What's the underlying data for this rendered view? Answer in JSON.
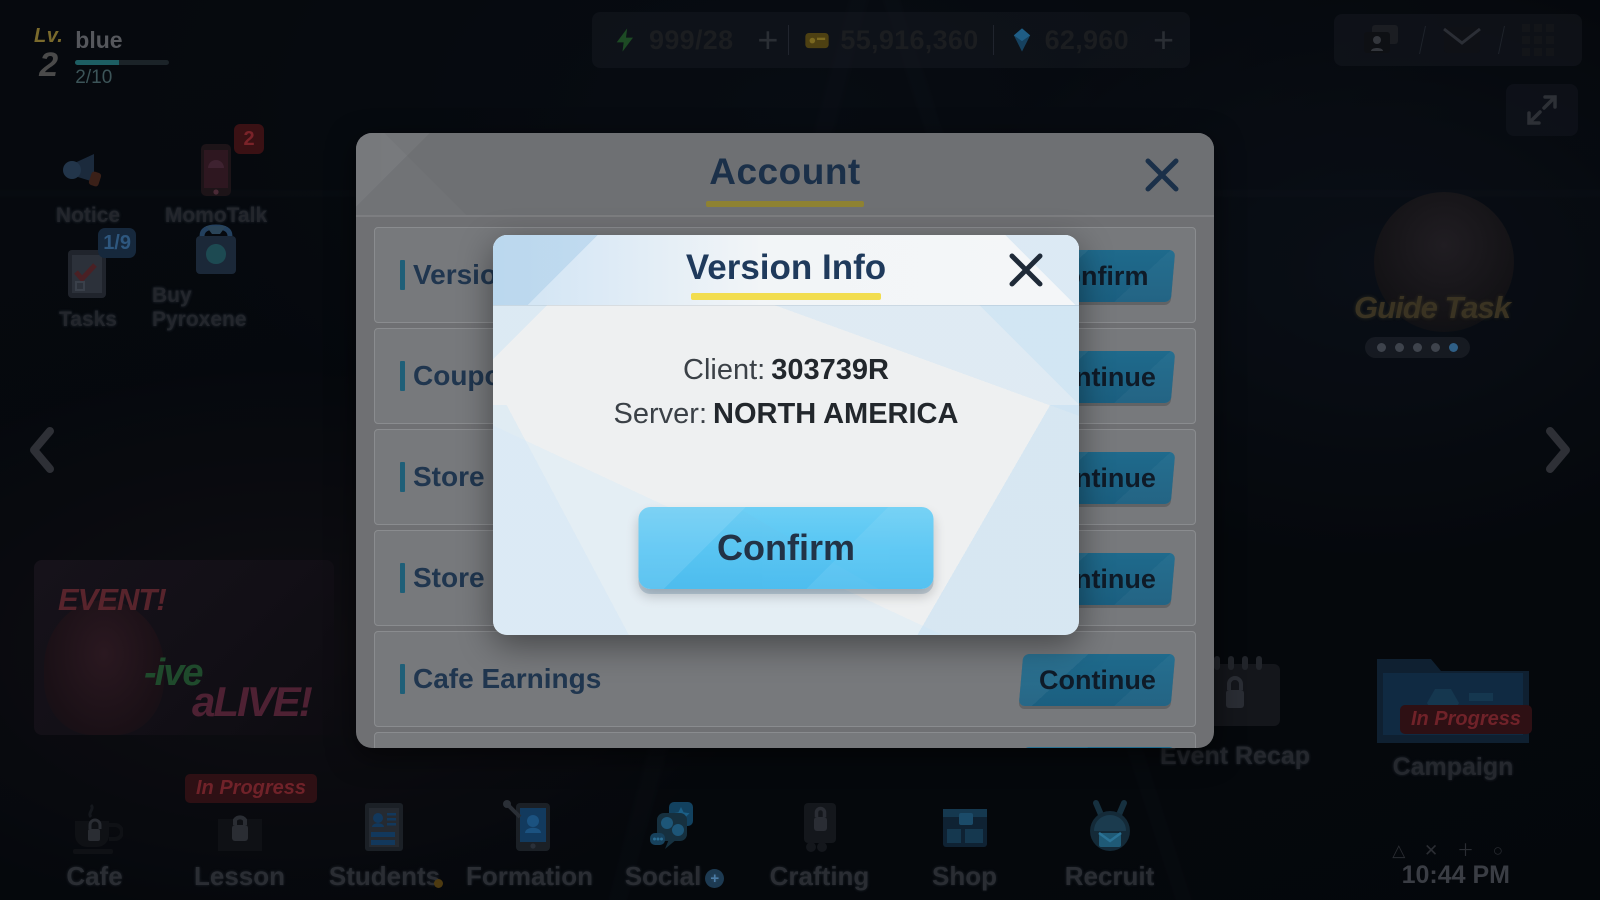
{
  "player": {
    "level_word": "Lv.",
    "level": "2",
    "name": "blue",
    "xp": "2/10"
  },
  "currencies": [
    {
      "icon": "ap-bolt-icon",
      "value": "999/28",
      "plus": "+"
    },
    {
      "icon": "credit-icon",
      "value": "55,916,360",
      "plus": ""
    },
    {
      "icon": "pyroxene-icon",
      "value": "62,960",
      "plus": "+"
    }
  ],
  "top_right_buttons": [
    {
      "icon": "profile-card-icon",
      "name": "profile-card-button"
    },
    {
      "icon": "mail-icon",
      "name": "mail-button"
    },
    {
      "icon": "grid-menu-icon",
      "name": "menu-button"
    }
  ],
  "expand_button": {
    "icon": "expand-arrows-icon"
  },
  "left_menu": [
    {
      "label": "Notice",
      "icon": "megaphone-icon",
      "badge": ""
    },
    {
      "label": "MomoTalk",
      "icon": "phone-icon",
      "badge": "2",
      "badge_style": "red"
    },
    {
      "label": "Tasks",
      "icon": "clipboard-icon",
      "badge": "1/9",
      "badge_style": "blue"
    },
    {
      "label": "Buy Pyroxene",
      "icon": "gem-bag-icon",
      "badge": ""
    }
  ],
  "side_arrows": {
    "left": "chevron-left-icon",
    "right": "chevron-right-icon"
  },
  "event_banner": {
    "tag": "EVENT!",
    "line1": "-ive",
    "line2": "aLIVE!"
  },
  "guide_task": {
    "label": "Guide Task",
    "dots_total": 5,
    "dots_active_index": 4
  },
  "right_widgets": [
    {
      "label": "Event Recap",
      "icon": "locked-calendar-icon",
      "badge": ""
    },
    {
      "label": "Campaign",
      "icon": "campaign-folder-icon",
      "badge": "In Progress"
    }
  ],
  "clock": {
    "icons": "△ ✕ ＋ ○",
    "time": "10:44 PM"
  },
  "bottom_nav": [
    {
      "label": "Cafe",
      "icon": "coffee-locked-icon",
      "locked": true,
      "badge": ""
    },
    {
      "label": "Lesson",
      "icon": "lesson-locked-icon",
      "locked": true,
      "badge": "In Progress"
    },
    {
      "label": "Students",
      "icon": "students-icon",
      "locked": false,
      "dot": true
    },
    {
      "label": "Formation",
      "icon": "formation-icon",
      "locked": false,
      "badge": ""
    },
    {
      "label": "Social",
      "icon": "social-chat-icon",
      "locked": false,
      "plus": "+"
    },
    {
      "label": "Crafting",
      "icon": "crafting-locked-icon",
      "locked": true,
      "badge": ""
    },
    {
      "label": "Shop",
      "icon": "shop-icon",
      "locked": false,
      "badge": ""
    },
    {
      "label": "Recruit",
      "icon": "recruit-icon",
      "locked": false,
      "badge": ""
    }
  ],
  "account_dialog": {
    "title": "Account",
    "close_icon": "close-icon",
    "rows": [
      {
        "label": "Version Info",
        "button": "Confirm"
      },
      {
        "label": "Coupon Code",
        "button": "Continue"
      },
      {
        "label": "Store and Load Account Data",
        "button": "Continue"
      },
      {
        "label": "Store and Load Account Data",
        "button": "Continue"
      },
      {
        "label": "Cafe Earnings",
        "button": "Continue"
      },
      {
        "label": "",
        "button": ""
      }
    ]
  },
  "version_modal": {
    "title": "Version Info",
    "close_icon": "close-icon",
    "fields": [
      {
        "label": "Client:",
        "value": "303739R"
      },
      {
        "label": "Server:",
        "value": "NORTH AMERICA"
      }
    ],
    "confirm_label": "Confirm"
  },
  "colors": {
    "accent_yellow": "#f2dd4f",
    "confirm_blue": "#56c6f4",
    "row_button_teal": "#1f6a8c",
    "title_navy": "#1f3a5c",
    "account_gray": "#6f7073"
  }
}
